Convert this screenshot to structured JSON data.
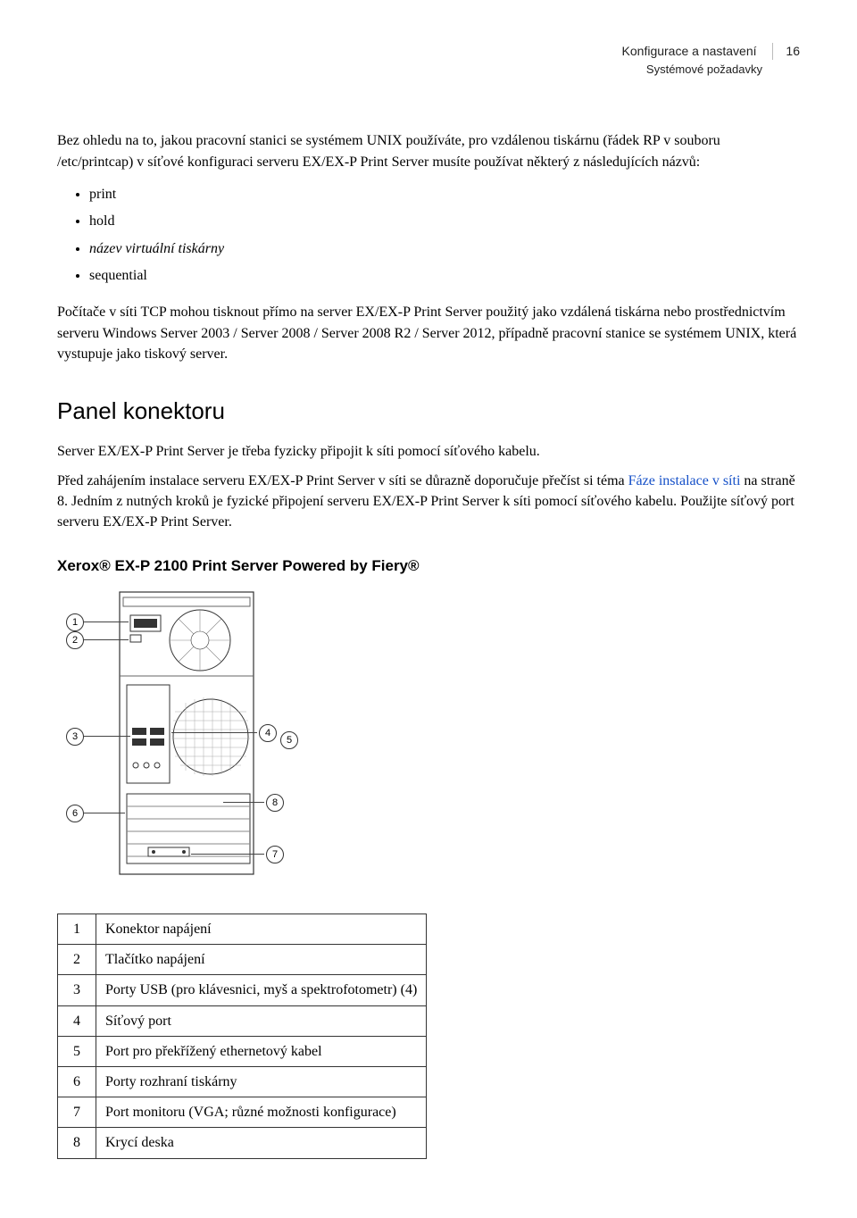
{
  "header": {
    "title": "Konfigurace a nastavení",
    "subtitle": "Systémové požadavky",
    "page": "16"
  },
  "intro": "Bez ohledu na to, jakou pracovní stanici se systémem UNIX používáte, pro vzdálenou tiskárnu (řádek RP v souboru /etc/printcap) v síťové konfiguraci serveru EX/EX-P Print Server musíte používat některý z následujících názvů:",
  "bullets": {
    "b1": "print",
    "b2": "hold",
    "b3": "název virtuální tiskárny",
    "b4": "sequential"
  },
  "after_bullets": "Počítače v síti TCP mohou tisknout přímo na server EX/EX-P Print Server použitý jako vzdálená tiskárna nebo prostřednictvím serveru Windows Server 2003 / Server 2008 / Server 2008 R2 / Server 2012, případně pracovní stanice se systémem UNIX, která vystupuje jako tiskový server.",
  "section_title": "Panel konektoru",
  "para1": "Server EX/EX-P Print Server je třeba fyzicky připojit k síti pomocí síťového kabelu.",
  "para2_a": "Před zahájením instalace serveru EX/EX-P Print Server v síti se důrazně doporučuje přečíst si téma ",
  "para2_link": "Fáze instalace v síti",
  "para2_b": " na straně 8. Jedním z nutných kroků je fyzické připojení serveru EX/EX-P Print Server k síti pomocí síťového kabelu. Použijte síťový port serveru EX/EX-P Print Server.",
  "sub_title": "Xerox® EX-P 2100 Print Server Powered by Fiery®",
  "callouts": {
    "c1": "1",
    "c2": "2",
    "c3": "3",
    "c4": "4",
    "c5": "5",
    "c6": "6",
    "c7": "7",
    "c8": "8"
  },
  "legend": [
    {
      "n": "1",
      "t": "Konektor napájení"
    },
    {
      "n": "2",
      "t": "Tlačítko napájení"
    },
    {
      "n": "3",
      "t": "Porty USB (pro klávesnici, myš a spektrofotometr) (4)"
    },
    {
      "n": "4",
      "t": "Síťový port"
    },
    {
      "n": "5",
      "t": "Port pro překřížený ethernetový kabel"
    },
    {
      "n": "6",
      "t": "Porty rozhraní tiskárny"
    },
    {
      "n": "7",
      "t": "Port monitoru (VGA; různé možnosti konfigurace)"
    },
    {
      "n": "8",
      "t": "Krycí deska"
    }
  ]
}
